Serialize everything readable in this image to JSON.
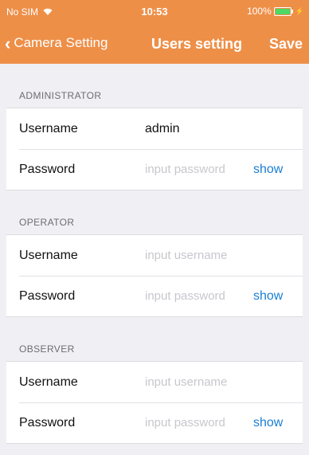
{
  "status": {
    "carrier": "No SIM",
    "time": "10:53",
    "battery": "100%",
    "battery_color": "#4cd964"
  },
  "nav": {
    "back_label": "Camera Setting",
    "title": "Users setting",
    "save_label": "Save"
  },
  "colors": {
    "header": "#ee8f48",
    "link": "#1a7fd4"
  },
  "sections": [
    {
      "title": "ADMINISTRATOR",
      "username_label": "Username",
      "username_value": "admin",
      "password_label": "Password",
      "password_placeholder": "input password",
      "show_label": "show"
    },
    {
      "title": "OPERATOR",
      "username_label": "Username",
      "username_placeholder": "input username",
      "password_label": "Password",
      "password_placeholder": "input password",
      "show_label": "show"
    },
    {
      "title": "OBSERVER",
      "username_label": "Username",
      "username_placeholder": "input username",
      "password_label": "Password",
      "password_placeholder": "input password",
      "show_label": "show"
    }
  ]
}
